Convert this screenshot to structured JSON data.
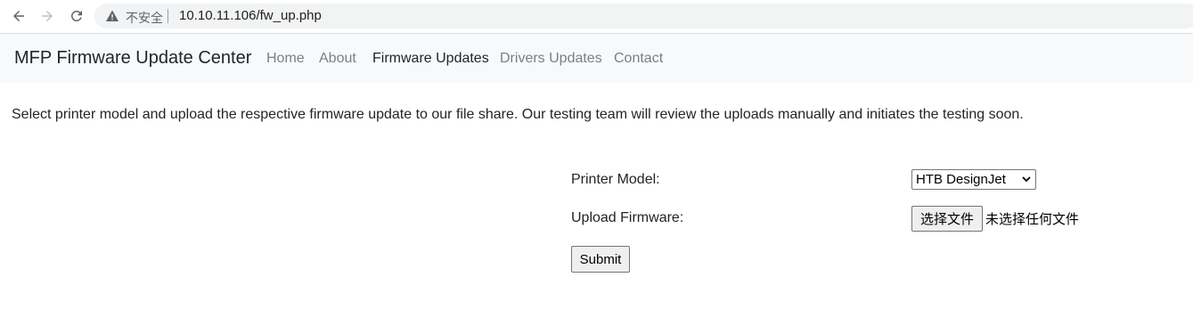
{
  "browser": {
    "security_label": "不安全",
    "url": "10.10.11.106/fw_up.php"
  },
  "navbar": {
    "brand": "MFP Firmware Update Center",
    "links": [
      {
        "label": "Home",
        "active": false
      },
      {
        "label": "About",
        "active": false
      },
      {
        "label": "Firmware Updates",
        "active": true
      },
      {
        "label": "Drivers Updates",
        "active": false
      },
      {
        "label": "Contact",
        "active": false
      }
    ]
  },
  "content": {
    "intro": "Select printer model and upload the respective firmware update to our file share. Our testing team will review the uploads manually and initiates the testing soon.",
    "form": {
      "printer_model_label": "Printer Model:",
      "printer_model_value": "HTB DesignJet",
      "upload_label": "Upload Firmware:",
      "file_button_label": "选择文件",
      "file_status": "未选择任何文件",
      "submit_label": "Submit"
    }
  }
}
